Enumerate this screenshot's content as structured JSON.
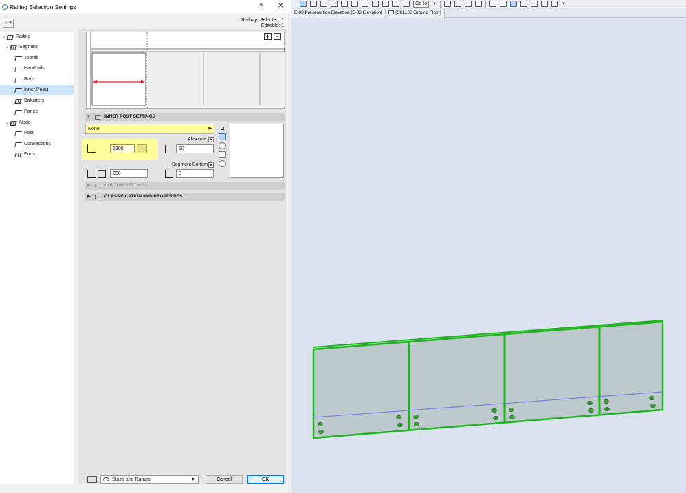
{
  "dialog": {
    "title": "Railing Selection Settings",
    "help_label": "?",
    "close_label": "✕",
    "railings_selected": "Railings Selected: 1",
    "editable": "Editable: 1",
    "favorites_icon": "favorites-icon"
  },
  "tree": {
    "items": [
      {
        "label": "Railing",
        "icon": "railing-icon"
      },
      {
        "label": "Segment",
        "icon": "segment-icon"
      },
      {
        "label": "Toprail",
        "icon": "toprail-icon"
      },
      {
        "label": "Handrails",
        "icon": "handrail-icon"
      },
      {
        "label": "Rails",
        "icon": "rail-icon"
      },
      {
        "label": "Inner Posts",
        "icon": "inner-post-icon",
        "selected": true
      },
      {
        "label": "Balusters",
        "icon": "baluster-icon"
      },
      {
        "label": "Panels",
        "icon": "panel-icon"
      },
      {
        "label": "Node",
        "icon": "node-icon"
      },
      {
        "label": "Post",
        "icon": "post-icon"
      },
      {
        "label": "Connections",
        "icon": "connection-icon"
      },
      {
        "label": "Ends",
        "icon": "end-icon"
      }
    ]
  },
  "preview": {
    "add_label": "+",
    "remove_label": "−"
  },
  "inner_post": {
    "section_title": "INNER POST SETTINGS",
    "profile": "None",
    "height": "1300",
    "offset_reference": "Absolute",
    "offset_value": "10",
    "spacing": "250",
    "bottom_reference": "Segment Bottom",
    "bottom_value": "0"
  },
  "sections": {
    "custom": "CUSTOM SETTINGS",
    "classification": "CLASSIFICATION AND PROPERTIES"
  },
  "footer": {
    "layer": "Stairs and Ramps",
    "cancel": "Cancel",
    "ok": "OK"
  },
  "viewport": {
    "toolbar_goto": "Go to",
    "tabs": [
      "E-03 Presentation Elevation [E-03 Elevation]",
      "[SK1100 Ground Floor]"
    ],
    "tab_hint": "- - - -"
  },
  "colors": {
    "railing_outline": "#1fb51f",
    "glass_fill": "#b7c4c6",
    "bottom_rail": "#7a80e6",
    "highlight": "#fffd9c",
    "dimension_arrow": "#e02020"
  }
}
